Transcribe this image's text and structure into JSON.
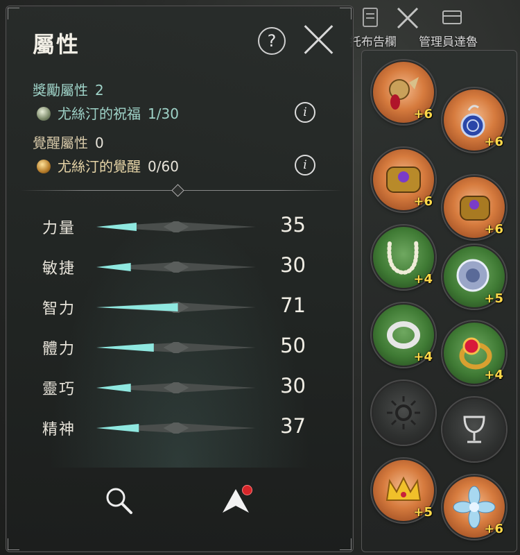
{
  "top_nav": {
    "items": [
      {
        "label": "托布告欄",
        "icon": "bulletin-board-icon"
      },
      {
        "label": "",
        "icon": "crossed-swords-icon"
      },
      {
        "label": "管理員達魯",
        "icon": "manager-chest-icon"
      }
    ]
  },
  "panel": {
    "title": "屬性",
    "help_label": "?",
    "reward_attr": {
      "label": "獎勵屬性",
      "value": "2"
    },
    "blessing": {
      "name": "尤絲汀的祝福",
      "value": "1/30",
      "icon": "blessing-gem-icon"
    },
    "awaken_attr": {
      "label": "覺醒屬性",
      "value": "0"
    },
    "awakening": {
      "name": "尤絲汀的覺醒",
      "value": "0/60",
      "icon": "awakening-gem-icon"
    },
    "info_label": "i"
  },
  "stats": [
    {
      "label": "力量",
      "value": "35"
    },
    {
      "label": "敏捷",
      "value": "30"
    },
    {
      "label": "智力",
      "value": "71"
    },
    {
      "label": "體力",
      "value": "50"
    },
    {
      "label": "靈巧",
      "value": "30"
    },
    {
      "label": "精神",
      "value": "37"
    }
  ],
  "bottom": {
    "search_icon": "magnifier-icon",
    "levelup_icon": "arrow-up-icon"
  },
  "equipment": [
    {
      "name": "brooch",
      "bg": "orange",
      "level": "+6",
      "icon": "brooch-icon"
    },
    {
      "name": "earring",
      "bg": "orange",
      "level": "+6",
      "icon": "earring-icon"
    },
    {
      "name": "bracelet-left",
      "bg": "orange",
      "level": "+6",
      "icon": "bracelet-icon"
    },
    {
      "name": "bracelet-right",
      "bg": "orange",
      "level": "+6",
      "icon": "bracelet-icon"
    },
    {
      "name": "necklace",
      "bg": "green",
      "level": "+4",
      "icon": "pearl-necklace-icon"
    },
    {
      "name": "amulet",
      "bg": "green",
      "level": "+5",
      "icon": "amulet-icon"
    },
    {
      "name": "ring-left",
      "bg": "green",
      "level": "+4",
      "icon": "silver-ring-icon"
    },
    {
      "name": "ring-right",
      "bg": "green",
      "level": "+4",
      "icon": "ruby-ring-icon"
    },
    {
      "name": "empty-rune",
      "bg": "empty",
      "level": "",
      "icon": "sun-rune-icon"
    },
    {
      "name": "empty-chalice",
      "bg": "empty",
      "level": "",
      "icon": "chalice-icon"
    },
    {
      "name": "crown",
      "bg": "orange",
      "level": "+5",
      "icon": "crown-icon"
    },
    {
      "name": "flower-brooch",
      "bg": "orange",
      "level": "+6",
      "icon": "flower-brooch-icon"
    }
  ]
}
